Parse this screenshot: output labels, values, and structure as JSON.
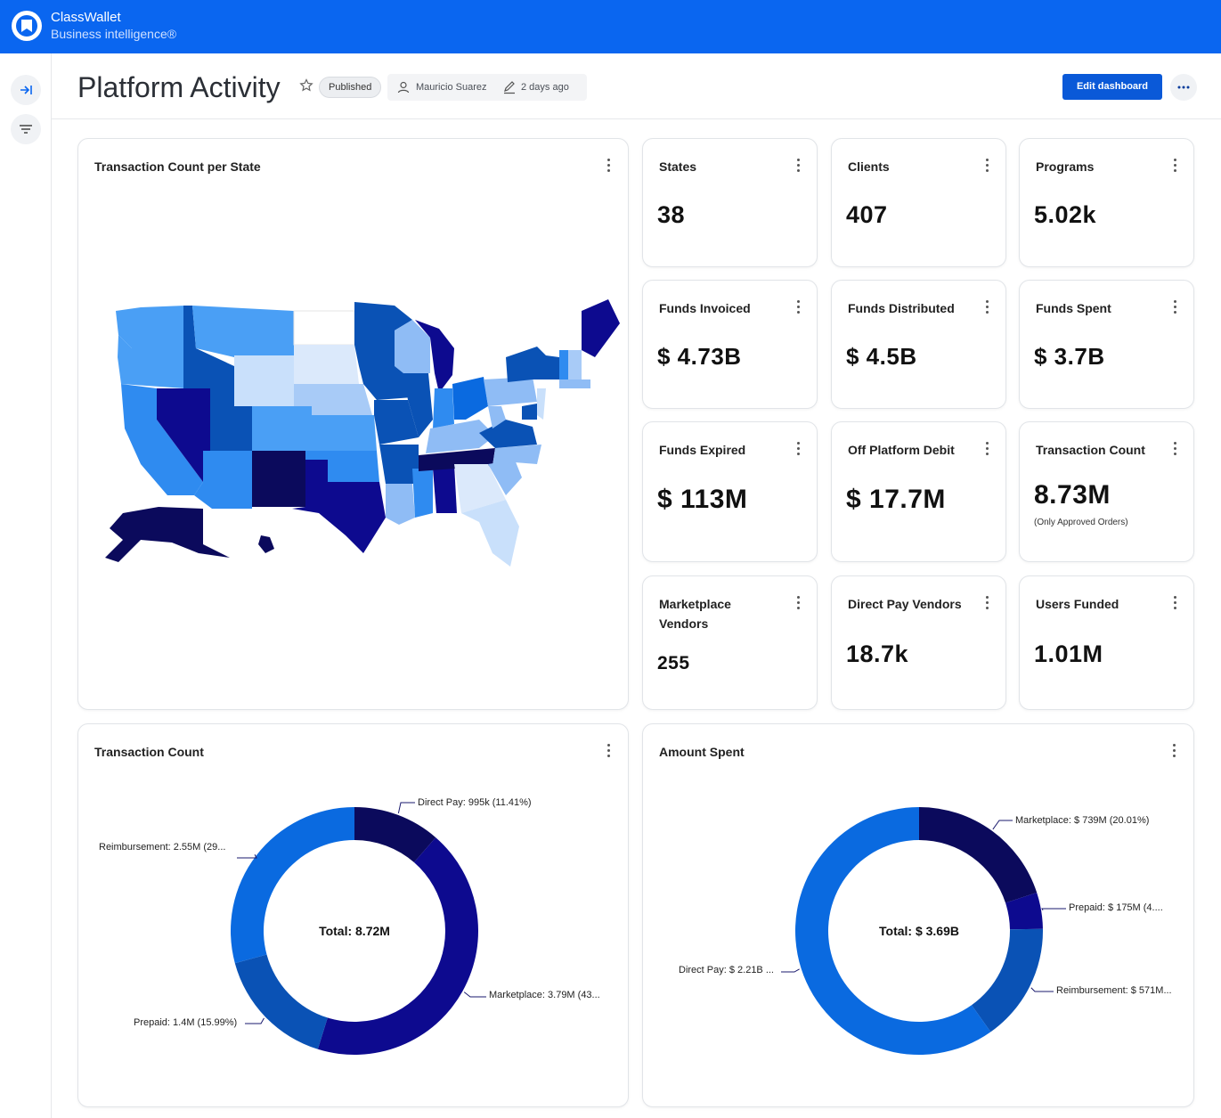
{
  "app": {
    "name": "ClassWallet",
    "subtitle": "Business intelligence®"
  },
  "header": {
    "title": "Platform Activity",
    "status_badge": "Published",
    "author": "Mauricio Suarez",
    "edited": "2 days ago",
    "edit_button": "Edit dashboard"
  },
  "map_card": {
    "title": "Transaction Count per State"
  },
  "kpis": [
    {
      "title": "States",
      "value": "38",
      "sub": ""
    },
    {
      "title": "Clients",
      "value": "407",
      "sub": ""
    },
    {
      "title": "Programs",
      "value": "5.02k",
      "sub": ""
    },
    {
      "title": "Funds Invoiced",
      "value": "$ 4.73B",
      "sub": ""
    },
    {
      "title": "Funds Distributed",
      "value": "$ 4.5B",
      "sub": ""
    },
    {
      "title": "Funds Spent",
      "value": "$ 3.7B",
      "sub": ""
    },
    {
      "title": "Funds Expired",
      "value": "$ 113M",
      "sub": ""
    },
    {
      "title": "Off Platform Debit",
      "value": "$ 17.7M",
      "sub": ""
    },
    {
      "title": "Transaction Count",
      "value": "8.73M",
      "sub": "(Only Approved Orders)"
    },
    {
      "title": "Marketplace Vendors",
      "value": "255",
      "sub": ""
    },
    {
      "title": "Direct Pay Vendors",
      "value": "18.7k",
      "sub": ""
    },
    {
      "title": "Users Funded",
      "value": "1.01M",
      "sub": ""
    }
  ],
  "colors": {
    "brand": "#0a66f0",
    "navy": "#0b0a5c",
    "indigo": "#0d0a8f",
    "royal": "#0a52b5",
    "azure": "#0a6ae0"
  },
  "chart_data": [
    {
      "type": "pie",
      "title": "Transaction Count",
      "center_label": "Total: 8.72M",
      "slices": [
        {
          "label": "Direct Pay",
          "value": 995000,
          "percent": 11.41,
          "text": "Direct Pay: 995k (11.41%)",
          "color": "#0b0a5c"
        },
        {
          "label": "Marketplace",
          "value": 3790000,
          "percent": 43.5,
          "text": "Marketplace: 3.79M (43...",
          "color": "#0d0a8f"
        },
        {
          "label": "Prepaid",
          "value": 1400000,
          "percent": 15.99,
          "text": "Prepaid: 1.4M (15.99%)",
          "color": "#0a52b5"
        },
        {
          "label": "Reimbursement",
          "value": 2550000,
          "percent": 29.1,
          "text": "Reimbursement: 2.55M (29...",
          "color": "#0a6ae0"
        }
      ]
    },
    {
      "type": "pie",
      "title": "Amount Spent",
      "center_label": "Total: $ 3.69B",
      "slices": [
        {
          "label": "Marketplace",
          "value": 739000000,
          "percent": 20.01,
          "text": "Marketplace: $ 739M (20.01%)",
          "color": "#0b0a5c"
        },
        {
          "label": "Prepaid",
          "value": 175000000,
          "percent": 4.7,
          "text": "Prepaid: $ 175M (4....",
          "color": "#0d0a8f"
        },
        {
          "label": "Reimbursement",
          "value": 571000000,
          "percent": 15.5,
          "text": "Reimbursement: $ 571M...",
          "color": "#0a52b5"
        },
        {
          "label": "Direct Pay",
          "value": 2210000000,
          "percent": 59.8,
          "text": "Direct Pay: $ 2.21B ...",
          "color": "#0a6ae0"
        }
      ]
    }
  ]
}
